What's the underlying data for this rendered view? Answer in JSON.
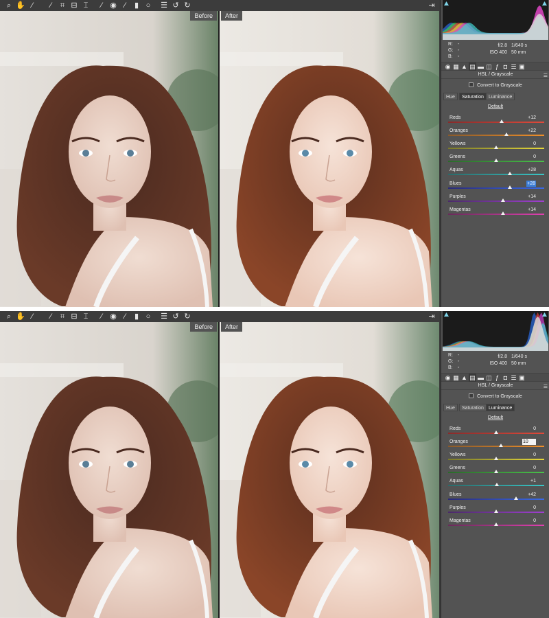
{
  "screens": [
    {
      "id": "top",
      "view_labels": {
        "before": "Before",
        "after": "After"
      },
      "histogram_profile": "saturation",
      "readout": {
        "r_label": "R:",
        "g_label": "G:",
        "b_label": "B:",
        "r": "---",
        "g": "---",
        "b": "---",
        "aperture": "f/2.8",
        "shutter": "1/640 s",
        "iso": "ISO 400",
        "focal": "50 mm"
      },
      "panel_title": "HSL / Grayscale",
      "grayscale_label": "Convert to Grayscale",
      "tabs": [
        "Hue",
        "Saturation",
        "Luminance"
      ],
      "active_tab": 1,
      "default_label": "Default",
      "sliders": [
        {
          "label": "Reds",
          "value": "+12",
          "level": 12,
          "state": ""
        },
        {
          "label": "Oranges",
          "value": "+22",
          "level": 22,
          "state": ""
        },
        {
          "label": "Yellows",
          "value": "0",
          "level": 0,
          "state": ""
        },
        {
          "label": "Greens",
          "value": "0",
          "level": 0,
          "state": ""
        },
        {
          "label": "Aquas",
          "value": "+28",
          "level": 28,
          "state": ""
        },
        {
          "label": "Blues",
          "value": "+28",
          "level": 28,
          "state": "selected"
        },
        {
          "label": "Purples",
          "value": "+14",
          "level": 14,
          "state": ""
        },
        {
          "label": "Magentas",
          "value": "+14",
          "level": 14,
          "state": ""
        }
      ]
    },
    {
      "id": "bottom",
      "view_labels": {
        "before": "Before",
        "after": "After"
      },
      "histogram_profile": "luminance",
      "readout": {
        "r_label": "R:",
        "g_label": "G:",
        "b_label": "B:",
        "r": "---",
        "g": "---",
        "b": "---",
        "aperture": "f/2.8",
        "shutter": "1/640 s",
        "iso": "ISO 400",
        "focal": "50 mm"
      },
      "panel_title": "HSL / Grayscale",
      "grayscale_label": "Convert to Grayscale",
      "tabs": [
        "Hue",
        "Saturation",
        "Luminance"
      ],
      "active_tab": 2,
      "default_label": "Default",
      "sliders": [
        {
          "label": "Reds",
          "value": "0",
          "level": 0,
          "state": ""
        },
        {
          "label": "Oranges",
          "value": "10",
          "level": 10,
          "state": "editing"
        },
        {
          "label": "Yellows",
          "value": "0",
          "level": 0,
          "state": ""
        },
        {
          "label": "Greens",
          "value": "0",
          "level": 0,
          "state": ""
        },
        {
          "label": "Aquas",
          "value": "+1",
          "level": 1,
          "state": ""
        },
        {
          "label": "Blues",
          "value": "+42",
          "level": 42,
          "state": ""
        },
        {
          "label": "Purples",
          "value": "0",
          "level": 0,
          "state": ""
        },
        {
          "label": "Magentas",
          "value": "0",
          "level": 0,
          "state": ""
        }
      ]
    }
  ],
  "toolbar": [
    {
      "icon": "zoom-icon",
      "glyph": "⌕"
    },
    {
      "icon": "hand-icon",
      "glyph": "✋"
    },
    {
      "icon": "white-balance-icon",
      "glyph": "⁄"
    },
    {
      "icon": "color-sampler-icon",
      "glyph": "⁄"
    },
    {
      "icon": "crop-icon",
      "glyph": "⌗"
    },
    {
      "icon": "straighten-icon",
      "glyph": "⊟"
    },
    {
      "icon": "transform-icon",
      "glyph": "⌶"
    },
    {
      "icon": "spot-removal-icon",
      "glyph": "⁄"
    },
    {
      "icon": "red-eye-icon",
      "glyph": "◉"
    },
    {
      "icon": "adjustment-brush-icon",
      "glyph": "⁄"
    },
    {
      "icon": "graduated-filter-icon",
      "glyph": "▮"
    },
    {
      "icon": "radial-filter-icon",
      "glyph": "○"
    },
    {
      "icon": "preferences-icon",
      "glyph": "☰"
    },
    {
      "icon": "rotate-left-icon",
      "glyph": "↺"
    },
    {
      "icon": "rotate-right-icon",
      "glyph": "↻"
    }
  ],
  "panel_icons": [
    "basic-icon",
    "tone-curve-icon",
    "detail-icon",
    "hsl-icon",
    "split-toning-icon",
    "lens-icon",
    "effects-icon",
    "camera-calibration-icon",
    "presets-icon",
    "snapshots-icon"
  ],
  "panel_icon_glyphs": [
    "◉",
    "▦",
    "▲",
    "▤",
    "▬",
    "◫",
    "ƒ",
    "◘",
    "☰",
    "▣"
  ],
  "slider_colors": {
    "Reds": [
      "#8a2a2a",
      "#e04a3a"
    ],
    "Oranges": [
      "#8a5a2a",
      "#f0902a"
    ],
    "Yellows": [
      "#7a7a2a",
      "#e6d83a"
    ],
    "Greens": [
      "#2a6a2a",
      "#4ac04a"
    ],
    "Aquas": [
      "#2a6a6a",
      "#3ac6c6"
    ],
    "Blues": [
      "#2a2a7a",
      "#3a6ae6"
    ],
    "Purples": [
      "#4a2a6a",
      "#a040d0"
    ],
    "Magentas": [
      "#6a2a5a",
      "#e040b0"
    ]
  },
  "slider_range": [
    -100,
    100
  ]
}
